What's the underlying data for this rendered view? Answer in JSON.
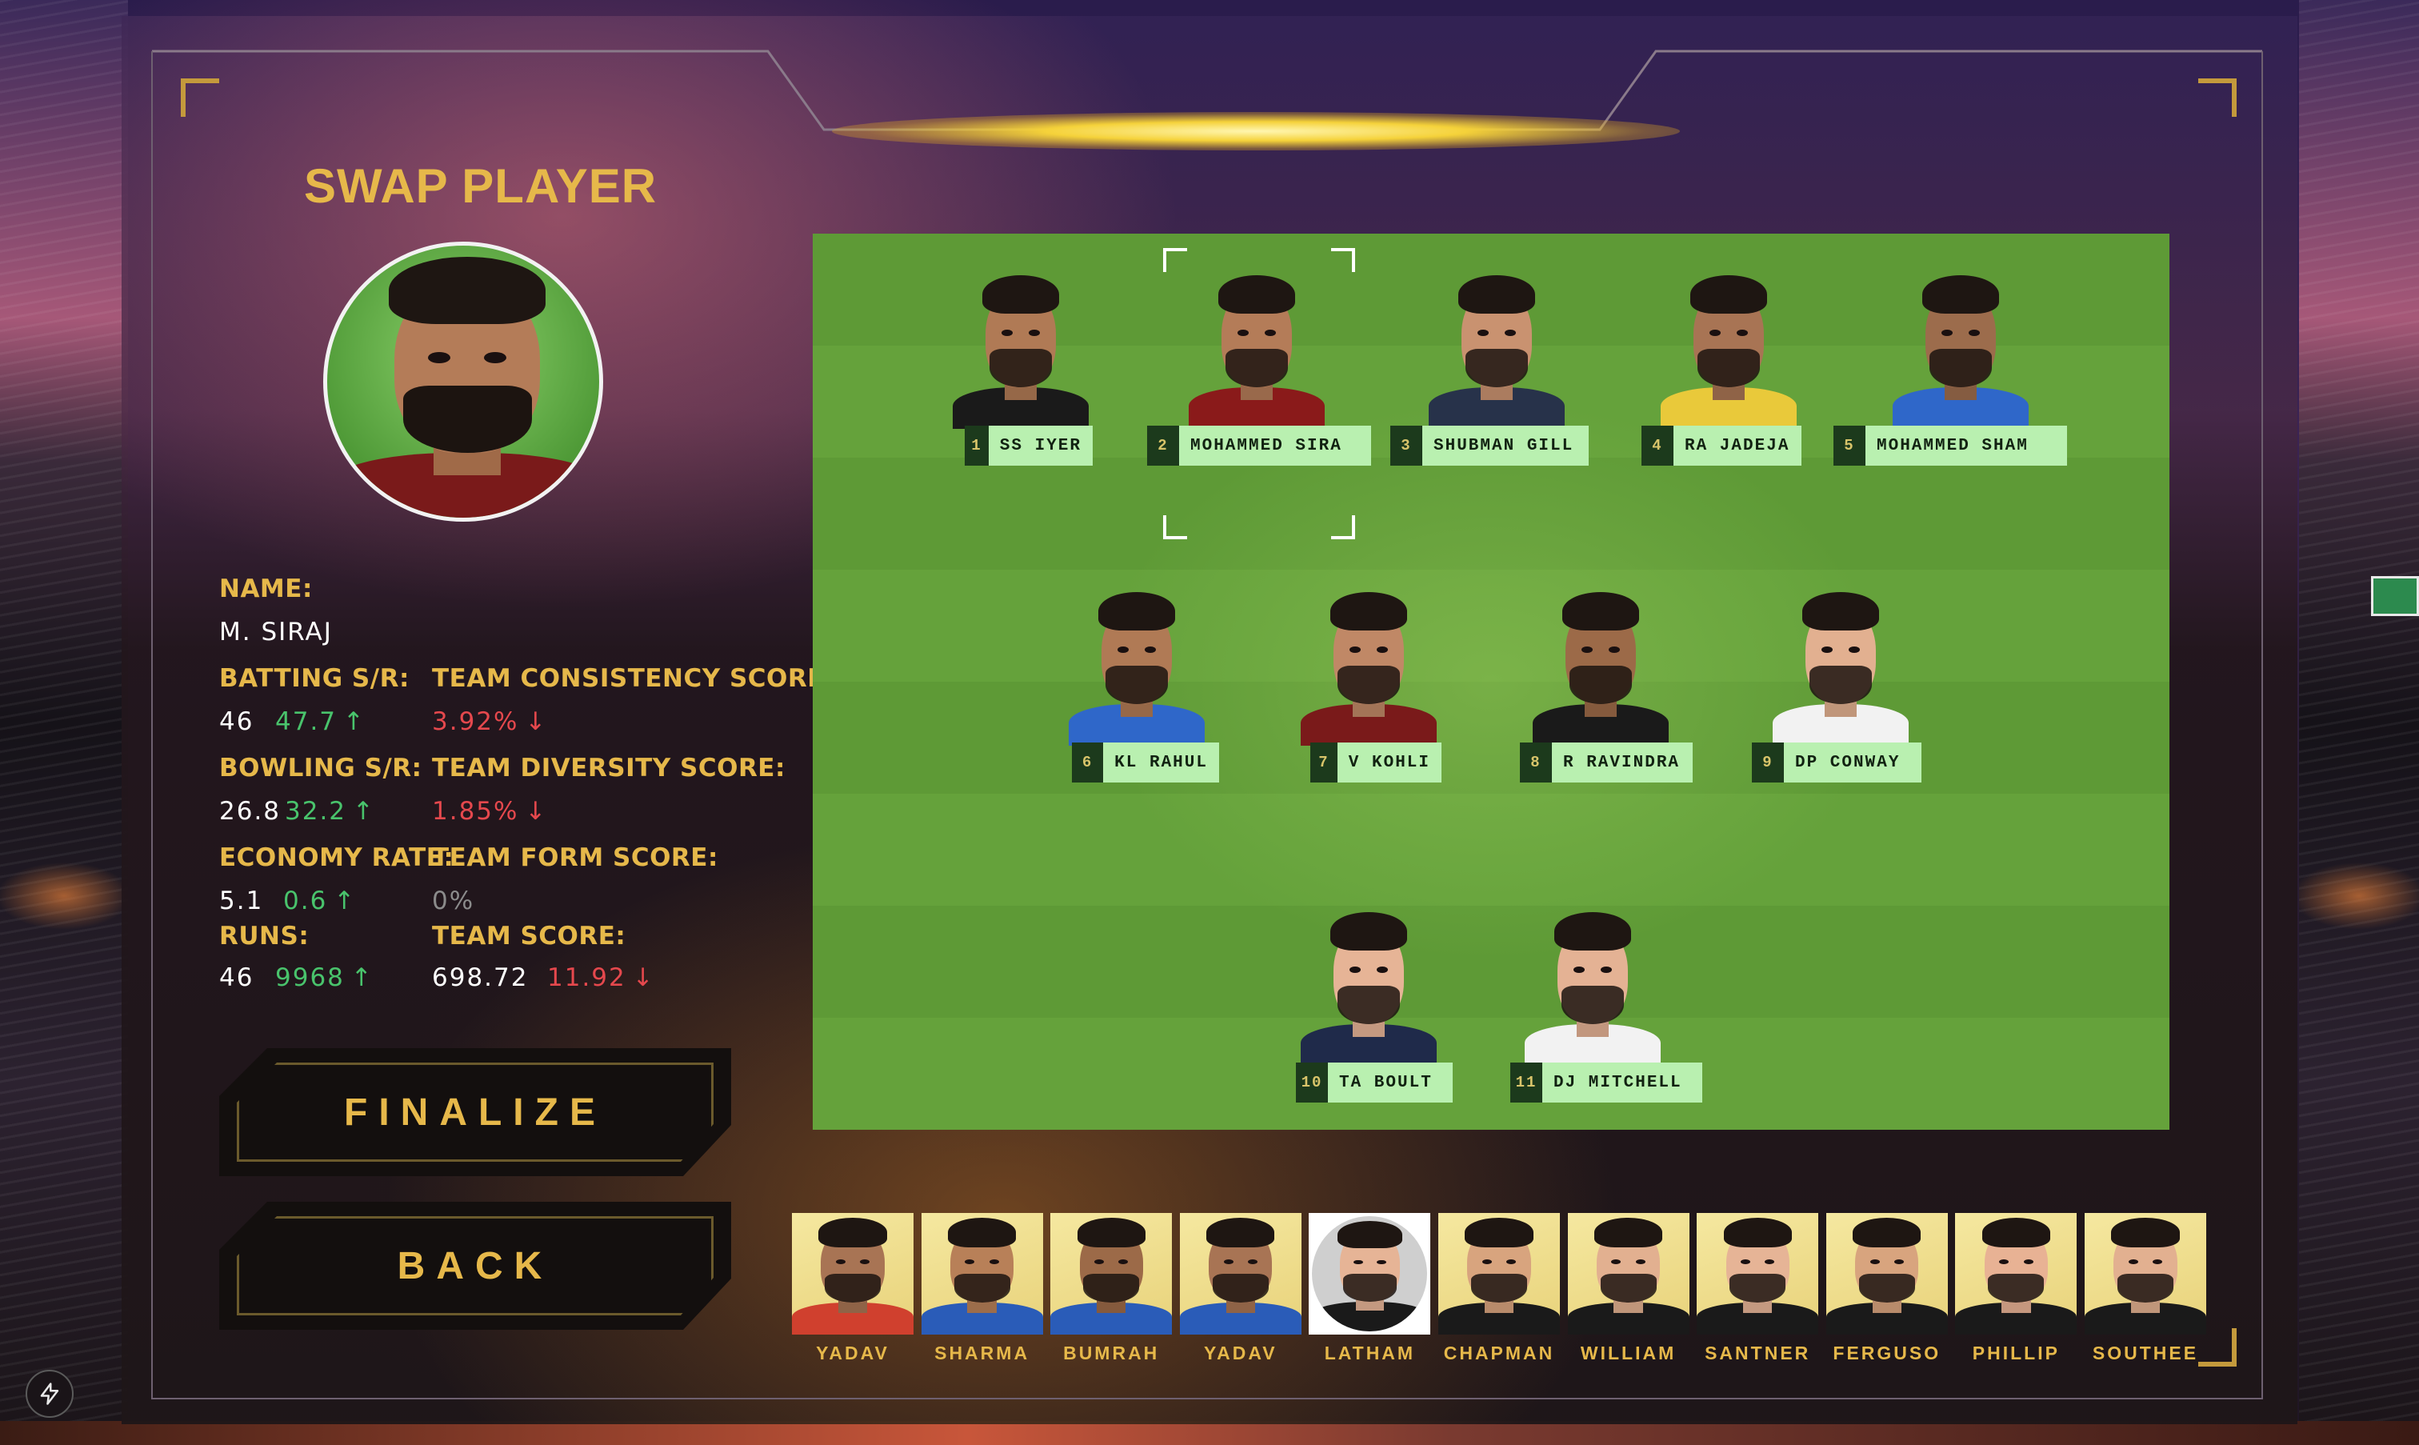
{
  "screen": {
    "title": "SWAP PLAYER"
  },
  "selected_player": {
    "name_label": "NAME:",
    "name": "M. SIRAJ",
    "stats": [
      {
        "label": "BATTING S/R:",
        "value": "46",
        "delta": "47.7",
        "direction": "up"
      },
      {
        "label": "BOWLING S/R:",
        "value": "26.8",
        "delta": "32.2",
        "direction": "up"
      },
      {
        "label": "ECONOMY RATE:",
        "value": "5.1",
        "delta": "0.6",
        "direction": "up"
      },
      {
        "label": "RUNS:",
        "value": "46",
        "delta": "9968",
        "direction": "up"
      }
    ]
  },
  "team_scores": [
    {
      "label": "TEAM CONSISTENCY SCORE:",
      "value": "",
      "delta": "3.92%",
      "direction": "down"
    },
    {
      "label": "TEAM DIVERSITY SCORE:",
      "value": "",
      "delta": "1.85%",
      "direction": "down"
    },
    {
      "label": "TEAM FORM SCORE:",
      "value": "",
      "delta": "0%",
      "direction": "neutral"
    },
    {
      "label": "TEAM SCORE:",
      "value": "698.72",
      "delta": "11.92",
      "direction": "down"
    }
  ],
  "arrows": {
    "up": "↑",
    "down": "↓"
  },
  "buttons": {
    "finalize": "FINALIZE",
    "back": "BACK"
  },
  "lineup": [
    {
      "number": "1",
      "name": "SS IYER",
      "shirt": "#1a1a1a",
      "skin": "#b07a55"
    },
    {
      "number": "2",
      "name": "MOHAMMED SIRA",
      "shirt": "#8a1a1a",
      "skin": "#b47c58",
      "selected": true
    },
    {
      "number": "3",
      "name": "SHUBMAN GILL",
      "shirt": "#27324a",
      "skin": "#c99270"
    },
    {
      "number": "4",
      "name": "RA JADEJA",
      "shirt": "#e9c93a",
      "skin": "#a87454"
    },
    {
      "number": "5",
      "name": "MOHAMMED SHAM",
      "shirt": "#2f67c9",
      "skin": "#9c6c4c"
    },
    {
      "number": "6",
      "name": "KL RAHUL",
      "shirt": "#2f67c9",
      "skin": "#b07a55"
    },
    {
      "number": "7",
      "name": "V KOHLI",
      "shirt": "#7a1a1a",
      "skin": "#c08866"
    },
    {
      "number": "8",
      "name": "R RAVINDRA",
      "shirt": "#1a1a1a",
      "skin": "#9c6a48"
    },
    {
      "number": "9",
      "name": "DP CONWAY",
      "shirt": "#f2f2f2",
      "skin": "#e2b090"
    },
    {
      "number": "10",
      "name": "TA BOULT",
      "shirt": "#1f2a4a",
      "skin": "#e6b496"
    },
    {
      "number": "11",
      "name": "DJ MITCHELL",
      "shirt": "#f2f2f2",
      "skin": "#e4b294"
    }
  ],
  "bench": [
    {
      "name": "YADAV",
      "shirt": "#d0402e",
      "skin": "#a87454"
    },
    {
      "name": "SHARMA",
      "shirt": "#2a5cb8",
      "skin": "#b88058"
    },
    {
      "name": "BUMRAH",
      "shirt": "#2a5cb8",
      "skin": "#9c6a48"
    },
    {
      "name": "YADAV",
      "shirt": "#2a5cb8",
      "skin": "#a87454"
    },
    {
      "name": "LATHAM",
      "shirt": "#1a1a1a",
      "skin": "#e6b496",
      "active": true
    },
    {
      "name": "CHAPMAN",
      "shirt": "#1a1a1a",
      "skin": "#d8a47e"
    },
    {
      "name": "WILLIAM",
      "shirt": "#1a1a1a",
      "skin": "#e2b090"
    },
    {
      "name": "SANTNER",
      "shirt": "#1a1a1a",
      "skin": "#e6b496"
    },
    {
      "name": "FERGUSO",
      "shirt": "#1a1a1a",
      "skin": "#d8a47e"
    },
    {
      "name": "PHILLIP",
      "shirt": "#1a1a1a",
      "skin": "#e8b294"
    },
    {
      "name": "SOUTHEE",
      "shirt": "#1a1a1a",
      "skin": "#e2b090"
    }
  ],
  "colors": {
    "accent": "#e6b84a",
    "positive": "#49c36c",
    "negative": "#e5484d",
    "pitch": "#5e9a36",
    "tag": "#b9f0b0"
  },
  "icons": {
    "corner_badge": "lightning-bolt-icon"
  }
}
